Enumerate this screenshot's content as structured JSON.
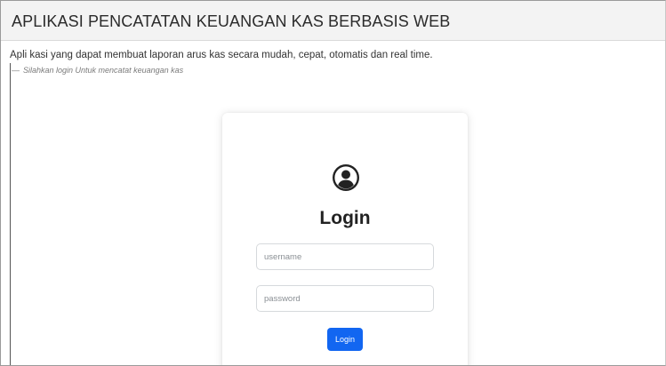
{
  "header": {
    "title": "APLIKASI PENCATATAN KEUANGAN KAS BERBASIS WEB"
  },
  "intro": {
    "lead": "Apli kasi yang dapat membuat laporan arus kas secara mudah, cepat, otomatis dan real time.",
    "footer_dash": "—",
    "footer_text": "Silahkan login Untuk mencatat keuangan kas"
  },
  "login_card": {
    "icon": "user-circle-icon",
    "title": "Login",
    "username_placeholder": "username",
    "password_placeholder": "password",
    "button_label": "Login"
  },
  "colors": {
    "header_bg": "#f3f3f3",
    "primary": "#1266f1"
  }
}
